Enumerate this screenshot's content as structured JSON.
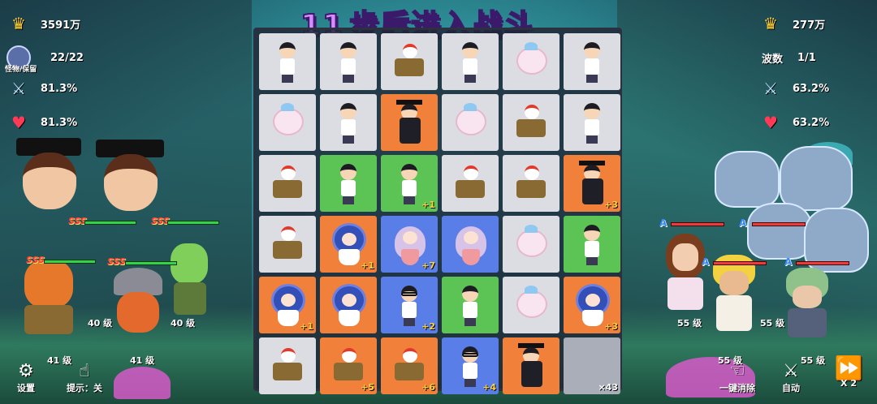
{
  "title": {
    "number": "11",
    "text": "步后进入战斗"
  },
  "left_hud": {
    "gold": "3591万",
    "monster_label": "怪物/保留",
    "monster_count": "22/22",
    "attack_pct": "81.3%",
    "hp_pct": "81.3%"
  },
  "right_hud": {
    "gold": "277万",
    "wave_label": "波数",
    "wave_value": "1/1",
    "attack_pct": "63.2%",
    "hp_pct": "63.2%"
  },
  "board": {
    "rows": 6,
    "cols": 6,
    "cells": [
      {
        "color": "grey",
        "unit": "boy"
      },
      {
        "color": "grey",
        "unit": "boy"
      },
      {
        "color": "grey",
        "unit": "cannon"
      },
      {
        "color": "grey",
        "unit": "boy"
      },
      {
        "color": "grey",
        "unit": "pig"
      },
      {
        "color": "grey",
        "unit": "boy"
      },
      {
        "color": "grey",
        "unit": "pig"
      },
      {
        "color": "grey",
        "unit": "boy"
      },
      {
        "color": "orange",
        "unit": "graduate"
      },
      {
        "color": "grey",
        "unit": "pig"
      },
      {
        "color": "grey",
        "unit": "cannon"
      },
      {
        "color": "grey",
        "unit": "boy"
      },
      {
        "color": "grey",
        "unit": "cannon"
      },
      {
        "color": "green",
        "unit": "boy"
      },
      {
        "color": "green",
        "unit": "boy",
        "plus": "+1"
      },
      {
        "color": "grey",
        "unit": "cannon"
      },
      {
        "color": "grey",
        "unit": "cannon"
      },
      {
        "color": "orange",
        "unit": "graduate",
        "plus": "+3"
      },
      {
        "color": "grey",
        "unit": "cannon"
      },
      {
        "color": "orange",
        "unit": "bluegirl",
        "plus": "+1"
      },
      {
        "color": "blue",
        "unit": "mermaid",
        "plus": "+7"
      },
      {
        "color": "blue",
        "unit": "mermaid"
      },
      {
        "color": "grey",
        "unit": "pig"
      },
      {
        "color": "green",
        "unit": "boy"
      },
      {
        "color": "orange",
        "unit": "bluegirl",
        "plus": "+1"
      },
      {
        "color": "orange",
        "unit": "bluegirl"
      },
      {
        "color": "blue",
        "unit": "glasses",
        "plus": "+2"
      },
      {
        "color": "green",
        "unit": "boy"
      },
      {
        "color": "grey",
        "unit": "pig"
      },
      {
        "color": "orange",
        "unit": "bluegirl",
        "plus": "+3"
      },
      {
        "color": "grey",
        "unit": "cannon"
      },
      {
        "color": "orange",
        "unit": "cannon",
        "plus": "+5"
      },
      {
        "color": "orange",
        "unit": "cannon",
        "plus": "+6"
      },
      {
        "color": "blue",
        "unit": "glasses",
        "plus": "+4"
      },
      {
        "color": "orange",
        "unit": "graduate"
      },
      {
        "color": "stone",
        "unit": "stone",
        "plus": "×43"
      }
    ]
  },
  "left_units": [
    {
      "level": "41 级",
      "rank": "SSS"
    },
    {
      "level": "41 级",
      "rank": "SSS"
    },
    {
      "level": "40 级",
      "rank": "SSS"
    },
    {
      "level": "40 级",
      "rank": "SSS"
    }
  ],
  "right_units": [
    {
      "level": "55 级",
      "grade": "A"
    },
    {
      "level": "55 级",
      "grade": "A"
    },
    {
      "level": "55 级",
      "grade": "A"
    },
    {
      "level": "55 级",
      "grade": "A"
    }
  ],
  "controls": {
    "settings": "设置",
    "hint": "提示：关",
    "clear_all": "一键消除",
    "auto": "自动",
    "speed": "X 2"
  }
}
